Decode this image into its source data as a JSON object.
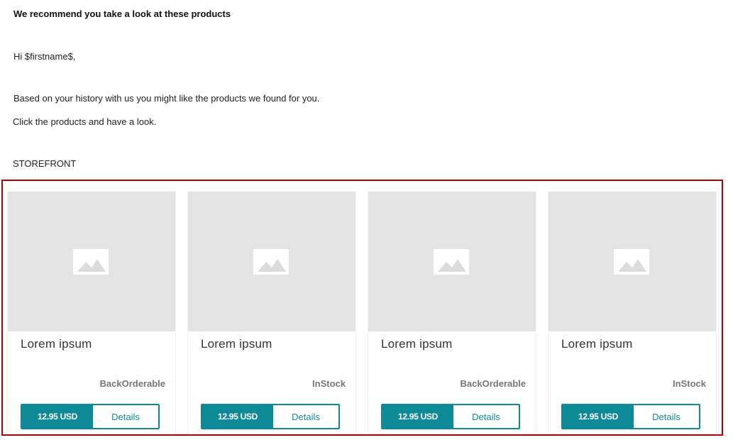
{
  "email": {
    "heading": "We recommend you take a look at these products",
    "greeting": "Hi $firstname$,",
    "intro": "Based on your history with us you might like the products we found for you.",
    "cta": "Click the products and have a look.",
    "storefront_label": "STOREFRONT"
  },
  "colors": {
    "accent": "#0e8a96",
    "storefront_border": "#b00000",
    "image_placeholder": "#e4e4e4",
    "stock_text": "#777777"
  },
  "products": [
    {
      "name": "Lorem ipsum",
      "stock": "BackOrderable",
      "price": "12.95 USD",
      "details_label": "Details",
      "image_icon": "image-placeholder-icon"
    },
    {
      "name": "Lorem ipsum",
      "stock": "InStock",
      "price": "12.95 USD",
      "details_label": "Details",
      "image_icon": "image-placeholder-icon"
    },
    {
      "name": "Lorem ipsum",
      "stock": "BackOrderable",
      "price": "12.95 USD",
      "details_label": "Details",
      "image_icon": "image-placeholder-icon"
    },
    {
      "name": "Lorem ipsum",
      "stock": "InStock",
      "price": "12.95 USD",
      "details_label": "Details",
      "image_icon": "image-placeholder-icon"
    }
  ]
}
